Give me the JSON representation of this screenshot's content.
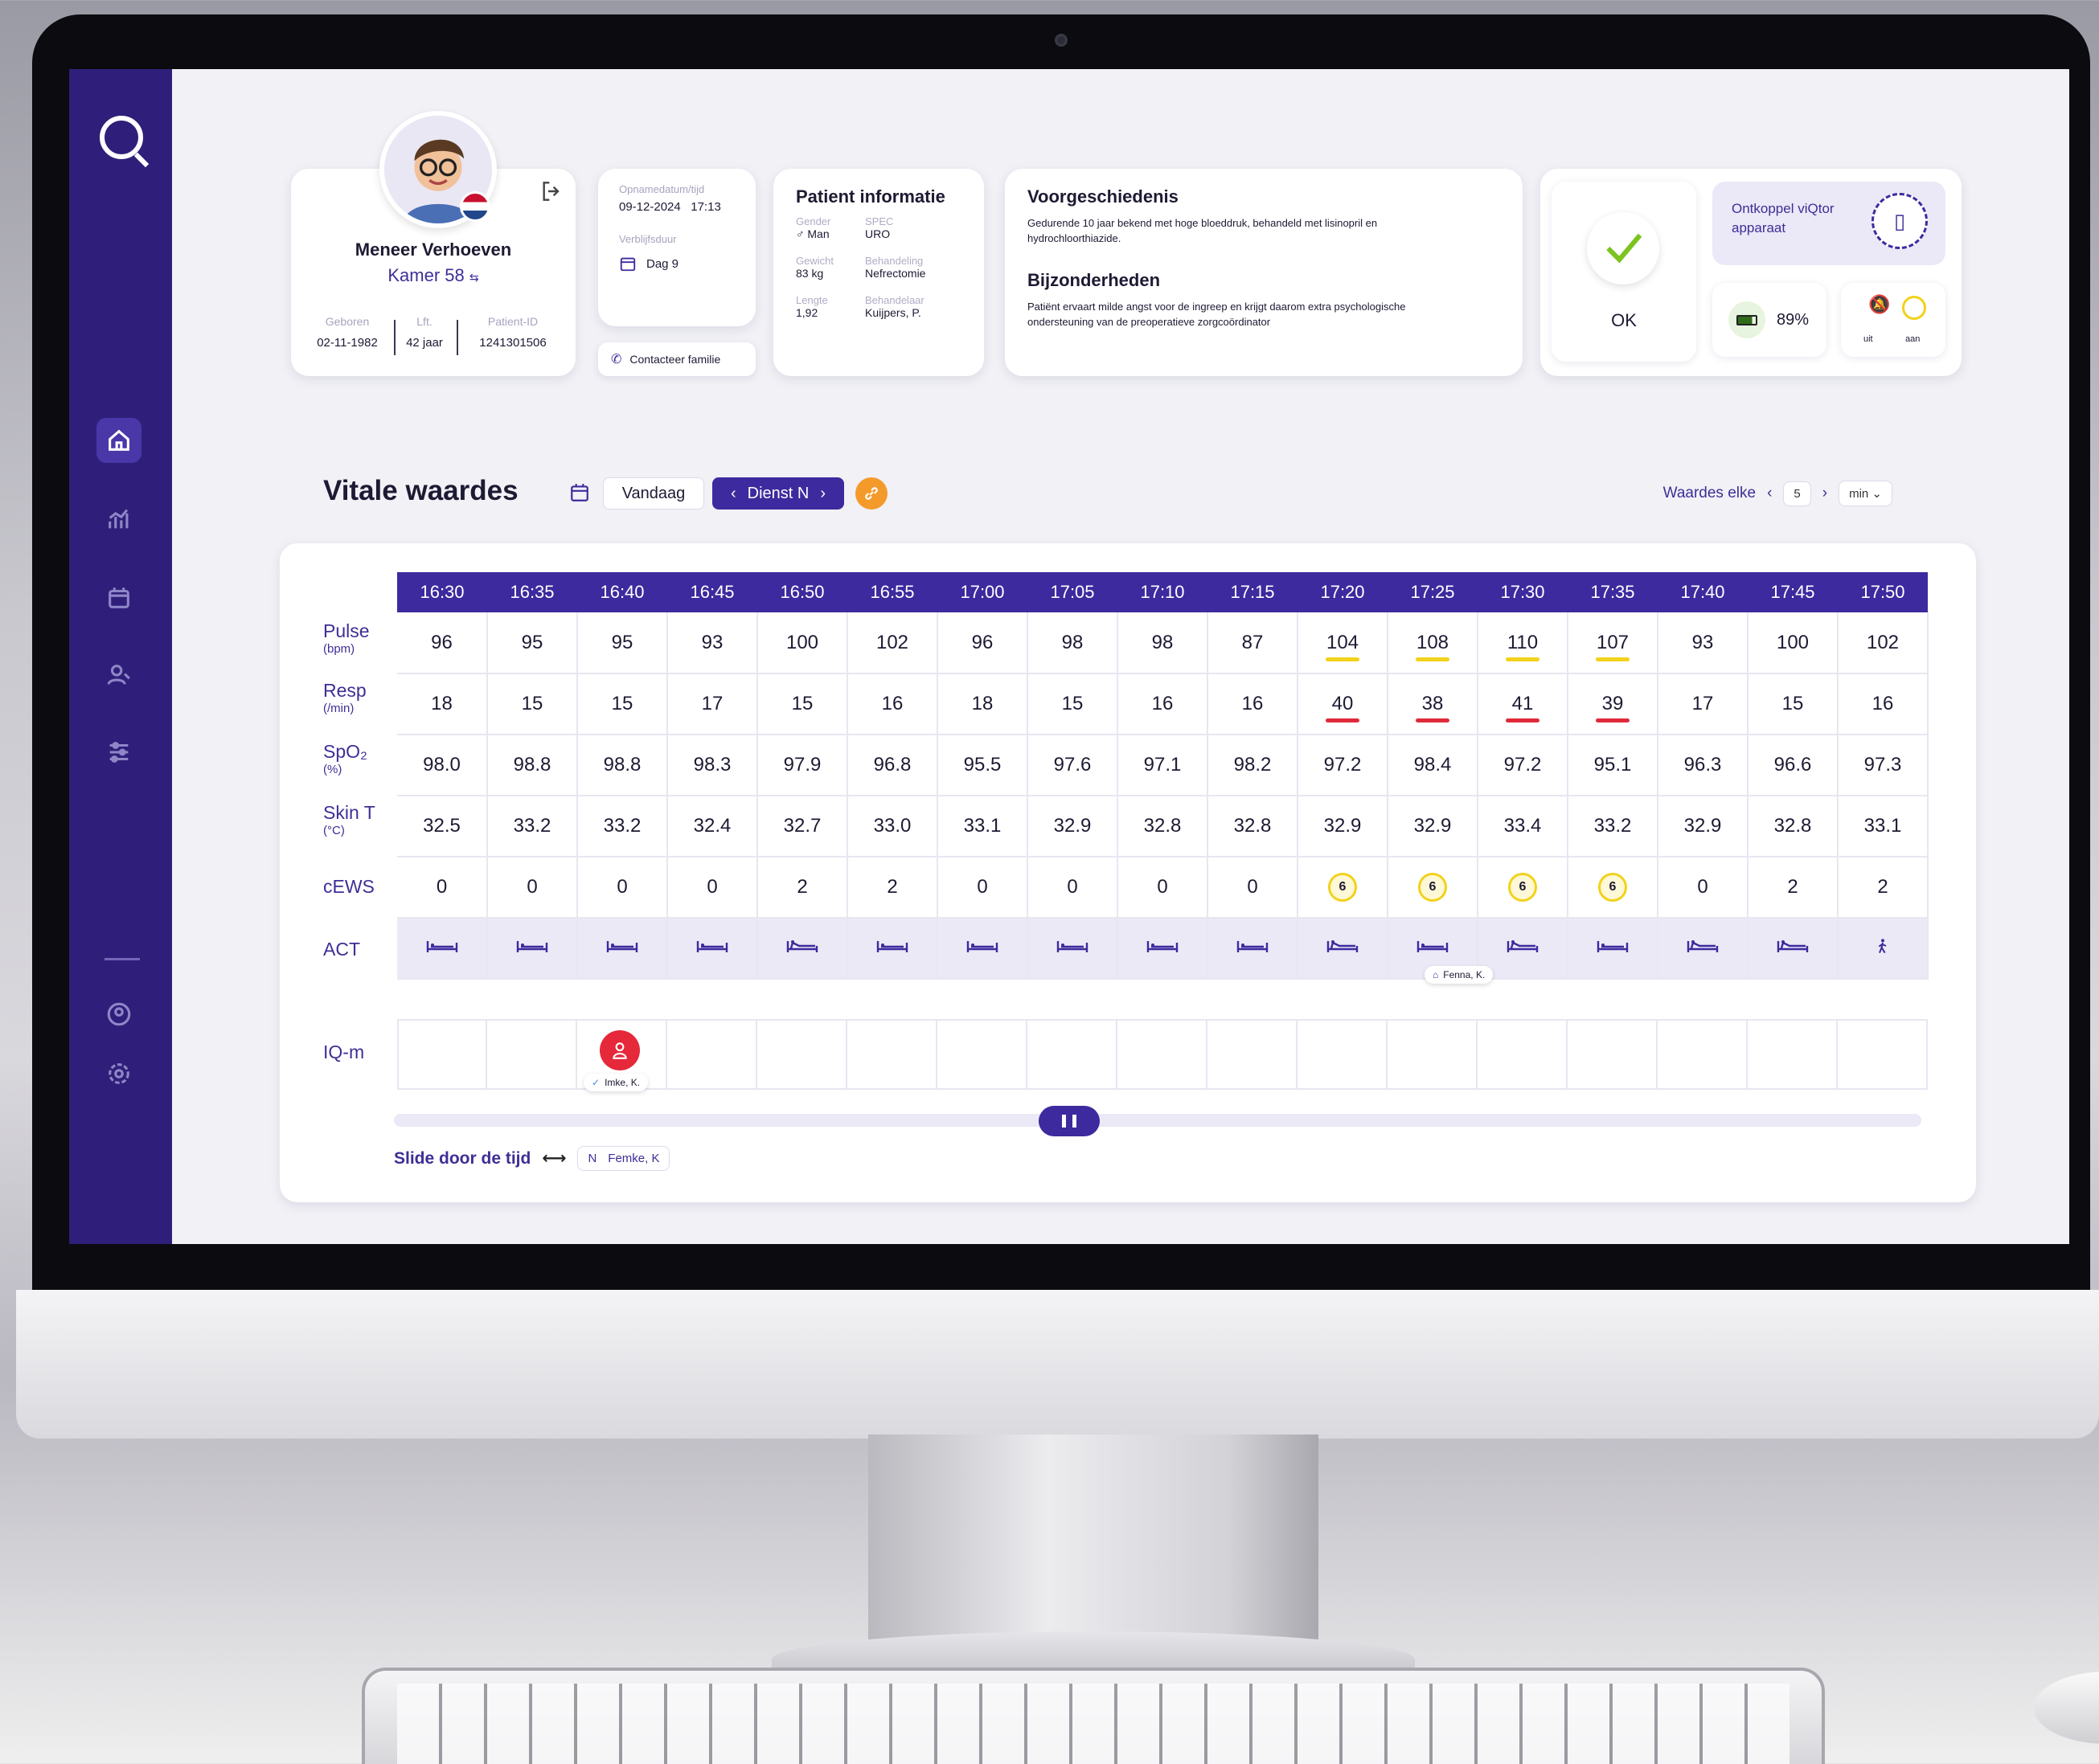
{
  "patient": {
    "name": "Meneer Verhoeven",
    "room": "Kamer 58",
    "born_label": "Geboren",
    "born": "02-11-1982",
    "age_label": "Lft.",
    "age": "42 jaar",
    "id_label": "Patient-ID",
    "id": "1241301506"
  },
  "admission": {
    "date_label": "Opnamedatum/tijd",
    "date": "09-12-2024",
    "time": "17:13",
    "stay_label": "Verblijfsduur",
    "stay": "Dag 9",
    "contact_label": "Contacteer familie"
  },
  "info": {
    "title": "Patient informatie",
    "gender_label": "Gender",
    "gender": "♂ Man",
    "spec_label": "SPEC",
    "spec": "URO",
    "weight_label": "Gewicht",
    "weight": "83 kg",
    "treatment_label": "Behandeling",
    "treatment": "Nefrectomie",
    "length_label": "Lengte",
    "length": "1,92",
    "practitioner_label": "Behandelaar",
    "practitioner": "Kuijpers, P."
  },
  "history": {
    "title": "Voorgeschiedenis",
    "text": "Gedurende 10 jaar bekend met hoge bloeddruk, behandeld met lisinopril en hydrochloorthiazide.",
    "details_title": "Bijzonderheden",
    "details": "Patiënt ervaart milde angst voor de ingreep en krijgt daarom extra psychologische ondersteuning van de preoperatieve zorgcoördinator"
  },
  "status": {
    "ok": "OK",
    "disconnect": "Ontkoppel viQtor apparaat",
    "battery": "89%",
    "toggle_off": "uit",
    "toggle_on": "aan"
  },
  "vitals": {
    "title": "Vitale waardes",
    "today": "Vandaag",
    "shift": "Dienst N",
    "interval_label": "Waardes elke",
    "interval_value": "5",
    "interval_unit": "min",
    "times": [
      "16:30",
      "16:35",
      "16:40",
      "16:45",
      "16:50",
      "16:55",
      "17:00",
      "17:05",
      "17:10",
      "17:15",
      "17:20",
      "17:25",
      "17:30",
      "17:35",
      "17:40",
      "17:45",
      "17:50"
    ],
    "rows": [
      {
        "label": "Pulse",
        "unit": "(bpm)",
        "values": [
          "96",
          "95",
          "95",
          "93",
          "100",
          "102",
          "96",
          "98",
          "98",
          "87",
          "104",
          "108",
          "110",
          "107",
          "93",
          "100",
          "102"
        ],
        "flags": [
          "",
          "",
          "",
          "",
          "",
          "",
          "",
          "",
          "",
          "",
          "y",
          "y",
          "y",
          "y",
          "",
          "",
          ""
        ]
      },
      {
        "label": "Resp",
        "unit": "(/min)",
        "values": [
          "18",
          "15",
          "15",
          "17",
          "15",
          "16",
          "18",
          "15",
          "16",
          "16",
          "40",
          "38",
          "41",
          "39",
          "17",
          "15",
          "16"
        ],
        "flags": [
          "",
          "",
          "",
          "",
          "",
          "",
          "",
          "",
          "",
          "",
          "r",
          "r",
          "r",
          "r",
          "",
          "",
          ""
        ]
      },
      {
        "label": "SpO₂",
        "unit": "(%)",
        "values": [
          "98.0",
          "98.8",
          "98.8",
          "98.3",
          "97.9",
          "96.8",
          "95.5",
          "97.6",
          "97.1",
          "98.2",
          "97.2",
          "98.4",
          "97.2",
          "95.1",
          "96.3",
          "96.6",
          "97.3"
        ],
        "flags": []
      },
      {
        "label": "Skin T",
        "unit": "(°C)",
        "values": [
          "32.5",
          "33.2",
          "33.2",
          "32.4",
          "32.7",
          "33.0",
          "33.1",
          "32.9",
          "32.8",
          "32.8",
          "32.9",
          "32.9",
          "33.4",
          "33.2",
          "32.9",
          "32.8",
          "33.1"
        ],
        "flags": []
      },
      {
        "label": "cEWS",
        "unit": "",
        "values": [
          "0",
          "0",
          "0",
          "0",
          "2",
          "2",
          "0",
          "0",
          "0",
          "0",
          "6",
          "6",
          "6",
          "6",
          "0",
          "2",
          "2"
        ],
        "flags": [
          "",
          "",
          "",
          "",
          "",
          "",
          "",
          "",
          "",
          "",
          "b",
          "b",
          "b",
          "b",
          "",
          "",
          ""
        ]
      }
    ],
    "act_label": "ACT",
    "act": [
      "lying",
      "lying",
      "lying",
      "lying",
      "sitting",
      "lying",
      "lying",
      "lying",
      "lying",
      "lying",
      "sitting",
      "lying",
      "sitting",
      "lying",
      "sitting",
      "sitting",
      "walking"
    ],
    "act_tag": "Fenna, K.",
    "iqm_label": "IQ-m",
    "iqm_tag": "Imke, K.",
    "slide_label": "Slide door de tijd",
    "nurse_initial": "N",
    "nurse": "Femke, K"
  },
  "colors": {
    "primary": "#3d2a9e",
    "sidebar": "#2f1f7a",
    "warn_yellow": "#f2d21a",
    "warn_red": "#e02a3a",
    "accent_orange": "#f49a2a"
  }
}
